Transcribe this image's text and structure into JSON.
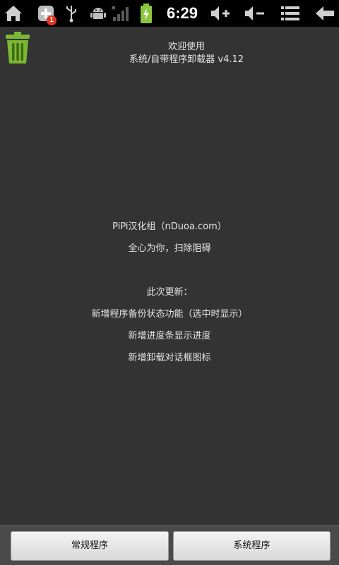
{
  "status_bar": {
    "time": "6:29",
    "notification_count": "1",
    "icons": [
      "home-icon",
      "add-icon",
      "usb-icon",
      "android-debug-icon",
      "signal-icon",
      "battery-icon",
      "volume-up-icon",
      "volume-down-icon",
      "menu-icon",
      "back-icon"
    ],
    "battery_color": "#8cc63f"
  },
  "header": {
    "welcome": "欢迎使用",
    "subtitle": "系统/自带程序卸载器  v4.12"
  },
  "info": {
    "credit": "PiPi汉化组（nDuoa.com）",
    "slogan": "全心为你，扫除阻碍",
    "update_title": "此次更新：",
    "updates": [
      "新增程序备份状态功能（选中时显示）",
      "新增进度条显示进度",
      "新增卸载对话框图标"
    ]
  },
  "buttons": {
    "regular": "常规程序",
    "system": "系统程序"
  },
  "colors": {
    "background": "#333333",
    "trash_green": "#7cb733"
  }
}
